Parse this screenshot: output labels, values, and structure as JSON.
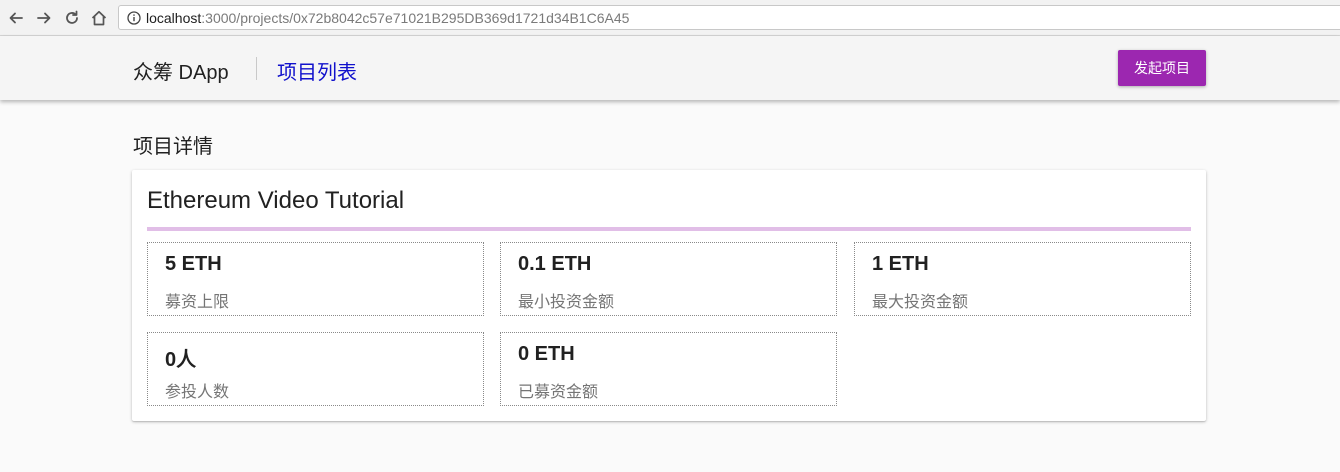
{
  "browser": {
    "url_host": "localhost",
    "url_rest": ":3000/projects/0x72b8042c57e71021B295DB369d1721d34B1C6A45"
  },
  "header": {
    "brand": "众筹 DApp",
    "nav_link": "项目列表",
    "create_button": "发起项目",
    "accent_color": "#9c27b0"
  },
  "page": {
    "title": "项目详情"
  },
  "project": {
    "name": "Ethereum Video Tutorial",
    "stats": [
      {
        "value": "5 ETH",
        "label": "募资上限"
      },
      {
        "value": "0.1 ETH",
        "label": "最小投资金额"
      },
      {
        "value": "1 ETH",
        "label": "最大投资金额"
      },
      {
        "value": "0人",
        "label": "参投人数"
      },
      {
        "value": "0 ETH",
        "label": "已募资金额"
      }
    ]
  }
}
